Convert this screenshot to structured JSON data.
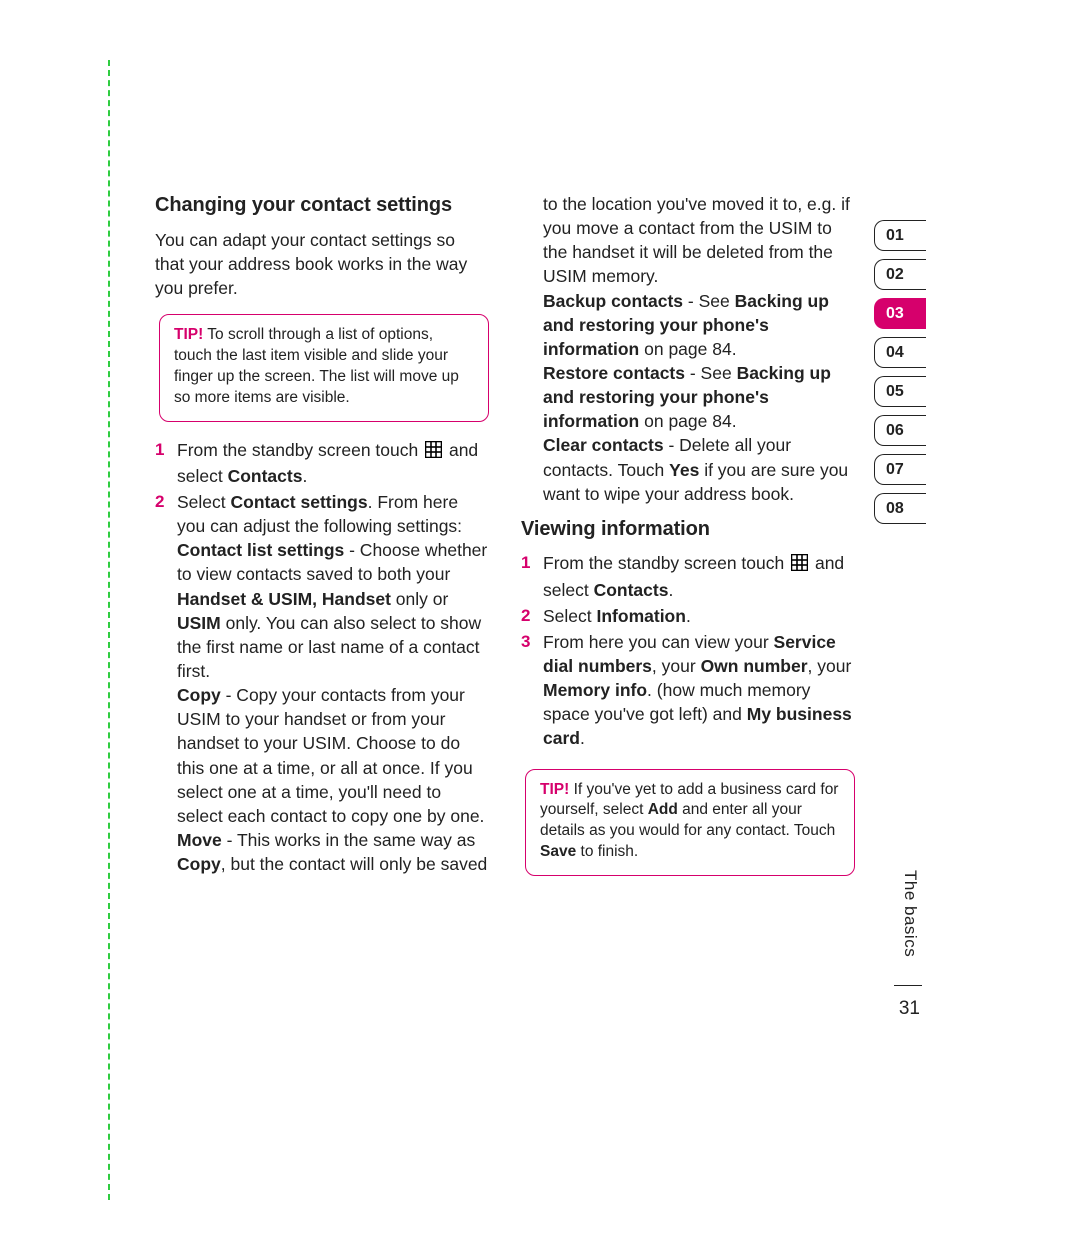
{
  "section1": {
    "heading": "Changing your contact settings",
    "intro": "You can adapt your contact settings so that your address book works in the way you prefer."
  },
  "tip1": {
    "label": "TIP!",
    "text": " To scroll through a list of options, touch the last item visible and slide your finger up the screen. The list will move up so more items are visible."
  },
  "s1_step1_a": "From the standby screen touch ",
  "s1_step1_b": " and select ",
  "s1_step1_contacts": "Contacts",
  "s1_step1_c": ".",
  "s1_step2_a": "Select ",
  "s1_step2_cs": "Contact settings",
  "s1_step2_b": ". From here you can adjust the following settings:",
  "cls_label": "Contact list settings",
  "cls_a": " - Choose whether to view contacts saved to both your ",
  "cls_opt": "Handset & USIM, Handset",
  "cls_b": " only or ",
  "cls_usim": "USIM",
  "cls_c": " only. You can also select to show the first name or last name of a contact first.",
  "copy_label": "Copy",
  "copy_text": " - Copy your contacts from your USIM to your handset or from your handset to your USIM. Choose to do this one at a time, or all at once. If you select one at a time, you'll need to select each contact to copy one by one.",
  "move_label": "Move",
  "move_a": " - This works in the same way as ",
  "move_copy": "Copy",
  "move_b": ", but the contact will only be saved to the location you've moved it to, e.g. if you move a contact from the USIM to the handset it will be deleted from the USIM memory.",
  "backup_label": "Backup contacts",
  "backup_a": " - See ",
  "backup_ref": "Backing up and restoring your phone's information",
  "backup_b": " on page 84.",
  "restore_label": "Restore contacts",
  "restore_a": " - See ",
  "restore_ref": "Backing up and restoring your phone's information",
  "restore_b": " on page 84.",
  "clear_label": "Clear contacts",
  "clear_a": " - Delete all your contacts. Touch ",
  "clear_yes": "Yes",
  "clear_b": " if you are sure you want to wipe your address book.",
  "section2": {
    "heading": "Viewing information"
  },
  "s2_step1_a": "From the standby screen touch ",
  "s2_step1_b": " and select ",
  "s2_step1_contacts": "Contacts",
  "s2_step1_c": ".",
  "s2_step2_a": "Select ",
  "s2_step2_info": "Infomation",
  "s2_step2_b": ".",
  "s2_step3_a": "From here you can view your ",
  "s2_step3_sdn": "Service dial numbers",
  "s2_step3_b": ", your ",
  "s2_step3_own": "Own number",
  "s2_step3_c": ", your ",
  "s2_step3_mem": "Memory info",
  "s2_step3_d": ". (how much memory space you've got left) and ",
  "s2_step3_card": "My business card",
  "s2_step3_e": ".",
  "tip2": {
    "label": "TIP!",
    "a": " If you've yet to add a business card for yourself, select ",
    "add": "Add",
    "b": " and enter all your details as you would for any contact. Touch ",
    "save": "Save",
    "c": " to finish."
  },
  "tabs": [
    "01",
    "02",
    "03",
    "04",
    "05",
    "06",
    "07",
    "08"
  ],
  "active_tab": "03",
  "side_label": "The basics",
  "page_number": "31",
  "nums": {
    "n1": "1",
    "n2": "2",
    "n3": "3"
  }
}
